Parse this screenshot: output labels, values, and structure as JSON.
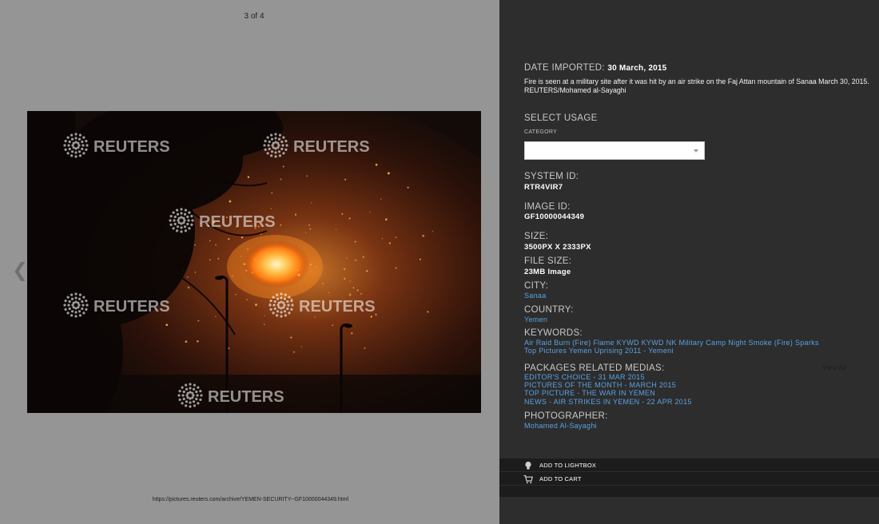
{
  "viewer": {
    "counter": "3 of 4",
    "prev_arrow_glyph": "❮",
    "url": "https://pictures.reuters.com/archive/YEMEN-SECURITY--GF10000044349.html",
    "watermark": "REUTERS"
  },
  "details": {
    "date_label": "DATE IMPORTED:",
    "date_value": "30 March, 2015",
    "caption": "Fire is seen at a military site after it was hit by an air strike on the Faj Attan mountain of Sanaa March 30, 2015. REUTERS/Mohamed al-Sayaghi",
    "select_usage_label": "SELECT USAGE",
    "category_label": "CATEGORY",
    "category_value": "",
    "system_id_label": "SYSTEM ID:",
    "system_id": "RTR4VIR7",
    "image_id_label": "IMAGE ID:",
    "image_id": "GF10000044349",
    "size_label": "SIZE:",
    "size": "3500PX X 2333PX",
    "file_size_label": "FILE SIZE:",
    "file_size": "23MB Image",
    "city_label": "CITY:",
    "city": "Sanaa",
    "country_label": "COUNTRY:",
    "country": "Yemen",
    "keywords_label": "KEYWORDS:",
    "keywords_line1": "Air Raid Burn (Fire) Flame KYWD KYWD NK Military Camp Night Smoke (Fire) Sparks",
    "keywords_line2": "Top Pictures Yemen Uprising 2011 - Yemeni",
    "packages_label": "PACKAGES RELATED MEDIAS:",
    "view_all": "View All",
    "packages": [
      "EDITOR'S CHOICE - 31 MAR 2015",
      "PICTURES OF THE MONTH - MARCH 2015",
      "TOP PICTURE - THE WAR IN YEMEN",
      "NEWS - AIR STRIKES IN YEMEN - 22 APR 2015"
    ],
    "photographer_label": "PHOTOGRAPHER:",
    "photographer": "Mohamed Al-Sayaghi"
  },
  "actions": {
    "lightbox": {
      "label": "ADD TO LIGHTBOX",
      "icon": "lightbulb-icon"
    },
    "cart": {
      "label": "ADD TO CART",
      "icon": "cart-icon"
    }
  },
  "colors": {
    "viewer_bg": "#959595",
    "panel_bg": "#2d2d2d",
    "link": "#5aa1e3",
    "action_bar": "#1c1c1c"
  }
}
